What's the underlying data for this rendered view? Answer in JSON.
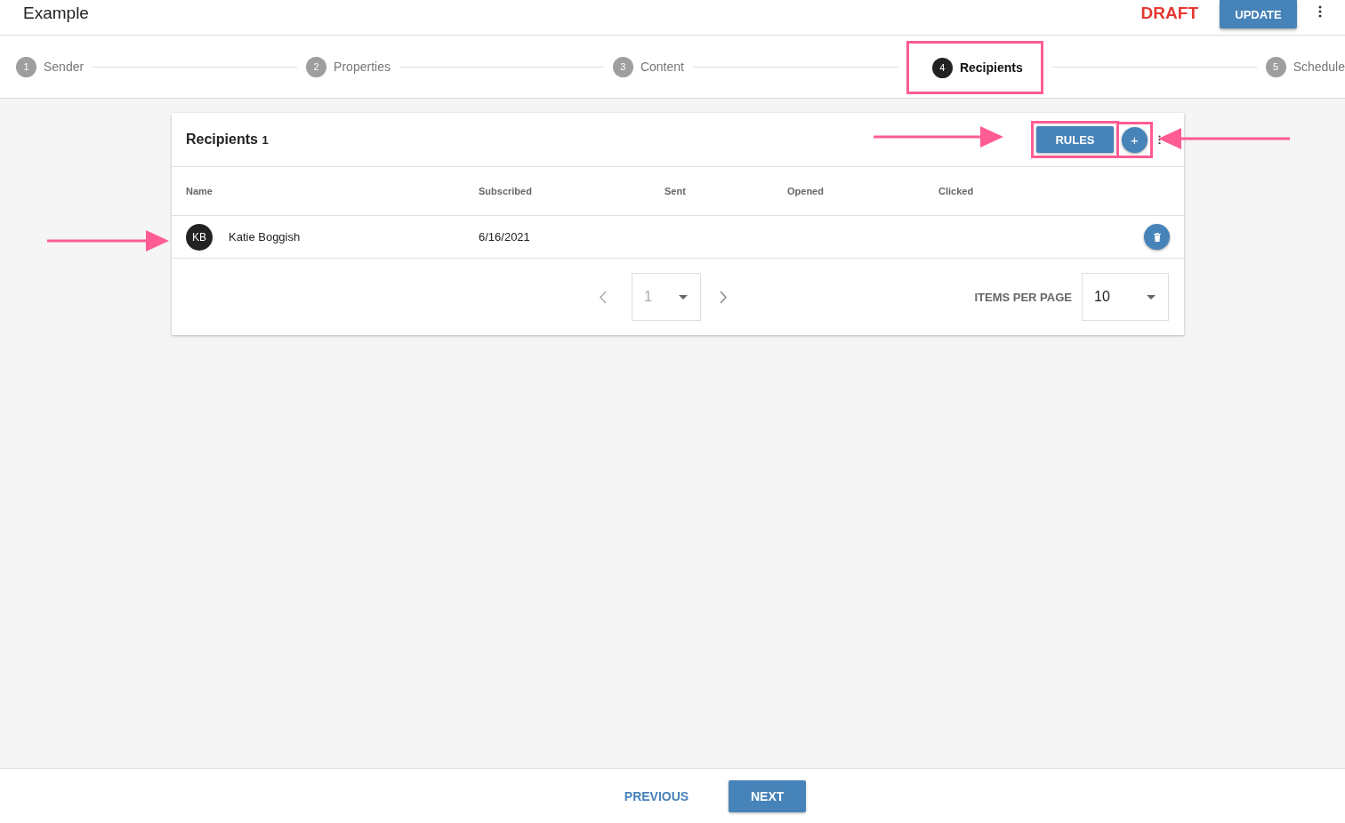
{
  "header": {
    "title": "Example",
    "status": "DRAFT",
    "action": "UPDATE"
  },
  "steps": [
    {
      "number": "1",
      "label": "Sender",
      "selected": false,
      "highlighted": false
    },
    {
      "number": "2",
      "label": "Properties",
      "selected": false,
      "highlighted": false
    },
    {
      "number": "3",
      "label": "Content",
      "selected": false,
      "highlighted": false
    },
    {
      "number": "4",
      "label": "Recipients",
      "selected": true,
      "highlighted": true
    },
    {
      "number": "5",
      "label": "Schedule",
      "selected": false,
      "highlighted": false
    }
  ],
  "card": {
    "title": "Recipients",
    "count": "1",
    "rules_button": {
      "label": "RULES",
      "highlighted": true
    },
    "add_button": {
      "label": "+",
      "highlighted": true
    },
    "table": {
      "columns": [
        "Name",
        "Subscribed",
        "Sent",
        "Opened",
        "Clicked"
      ],
      "rows": [
        {
          "initials": "KB",
          "name": "Katie Boggish",
          "subscribed": "6/16/2021"
        }
      ]
    },
    "pagination": {
      "page": "1",
      "items_per_page_label": "ITEMS PER PAGE",
      "items_per_page": "10"
    }
  },
  "footer": {
    "previous": "PREVIOUS",
    "next": "NEXT"
  }
}
